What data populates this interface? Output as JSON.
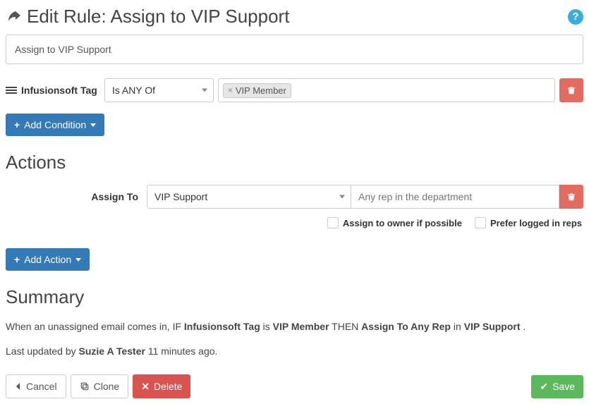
{
  "header": {
    "title_prefix": "Edit Rule:",
    "title_name": "Assign to VIP Support"
  },
  "rule_name_value": "Assign to VIP Support",
  "condition": {
    "field_label": "Infusionsoft Tag",
    "operator": "Is ANY Of",
    "tag_value": "VIP Member"
  },
  "buttons": {
    "add_condition": "Add Condition",
    "add_action": "Add Action",
    "cancel": "Cancel",
    "clone": "Clone",
    "delete": "Delete",
    "save": "Save"
  },
  "sections": {
    "actions": "Actions",
    "summary": "Summary"
  },
  "action": {
    "label": "Assign To",
    "department": "VIP Support",
    "rep_placeholder": "Any rep in the department",
    "owner_checkbox": "Assign to owner if possible",
    "prefer_checkbox": "Prefer logged in reps"
  },
  "summary": {
    "s1": "When an unassigned email comes in, IF ",
    "b1": "Infusionsoft Tag",
    "s2": " is ",
    "b2": "VIP Member",
    "s3": " THEN ",
    "b3": "Assign To Any Rep",
    "s4": " in ",
    "b4": "VIP Support",
    "s5": ".",
    "updated_prefix": "Last updated by ",
    "updated_user": "Suzie A Tester",
    "updated_suffix": " 11 minutes ago."
  }
}
